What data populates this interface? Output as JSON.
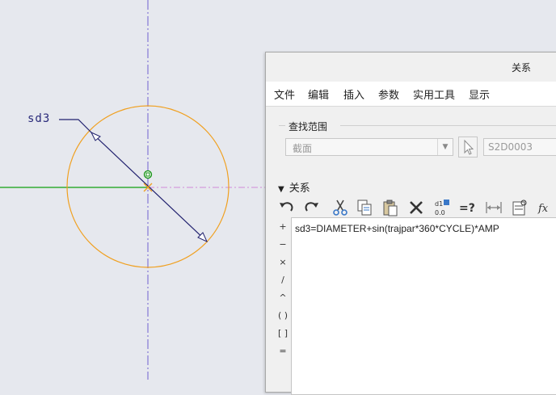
{
  "sketch": {
    "dimension_label": "sd3"
  },
  "dialog": {
    "title": "关系",
    "menu": [
      "文件",
      "编辑",
      "插入",
      "参数",
      "实用工具",
      "显示"
    ],
    "search_scope": {
      "group_title": "查找范围",
      "type_value": "截面",
      "selection_value": "S2D0003"
    },
    "relations": {
      "section_title": "关系",
      "toolbar_icons": [
        "undo-icon",
        "redo-icon",
        "cut-icon",
        "copy-icon",
        "paste-icon",
        "delete-icon",
        "switch-dimensions-icon",
        "verify-icon",
        "measure-icon",
        "parameter-table-icon",
        "function-icon"
      ],
      "operators": [
        "+",
        "−",
        "×",
        "/",
        "^",
        "( )",
        "[ ]",
        "="
      ],
      "text": "sd3=DIAMETER+sin(trajpar*360*CYCLE)*AMP"
    }
  },
  "colors": {
    "canvas": "#e6e8ee",
    "circle": "#f0a020",
    "horizontal_axis": "#10a010",
    "vertical_axis": "#7060d0",
    "dimension": "#20206e"
  }
}
